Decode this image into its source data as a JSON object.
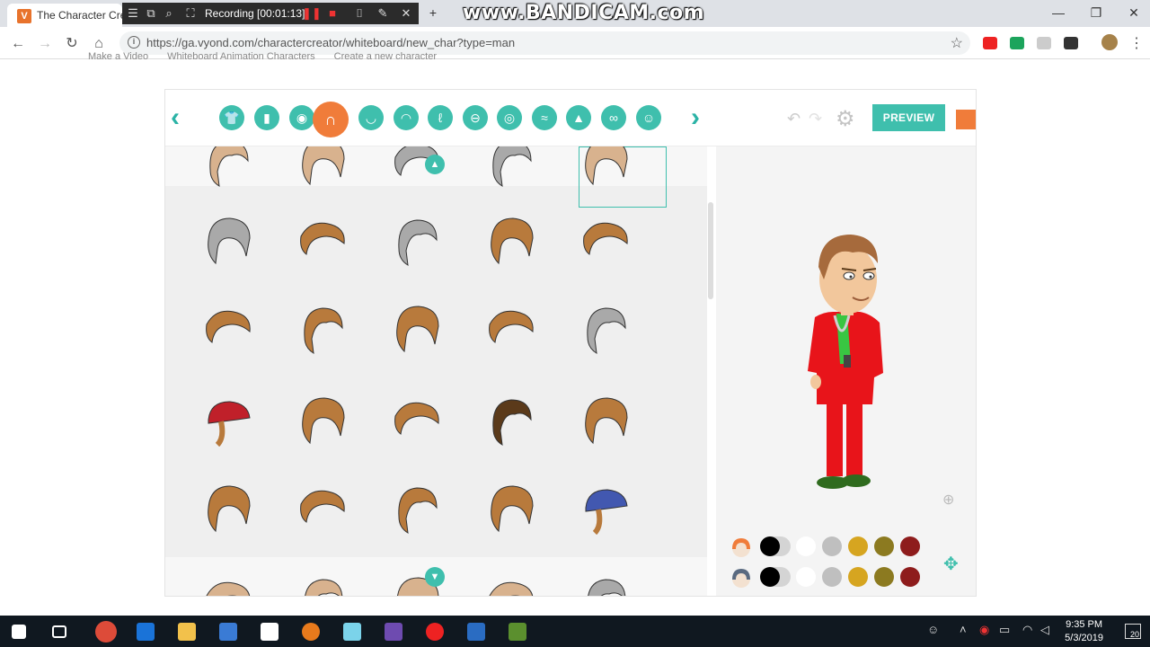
{
  "browser": {
    "tab_title": "The Character Crea",
    "tab_favicon_letter": "V",
    "url": "https://ga.vyond.com/charactercreator/whiteboard/new_char?type=man",
    "recording_label": "Recording [00:01:13]",
    "watermark": "www.BANDICAM.com"
  },
  "site_nav": {
    "items": [
      "Make a Video",
      "Whiteboard Animation Characters",
      "Create a new character"
    ]
  },
  "creator": {
    "categories": [
      {
        "name": "shirt",
        "glyph": "👕"
      },
      {
        "name": "pants",
        "glyph": "▮"
      },
      {
        "name": "face",
        "glyph": "◉"
      },
      {
        "name": "hair",
        "glyph": "∩"
      },
      {
        "name": "beard",
        "glyph": "◡"
      },
      {
        "name": "mouth",
        "glyph": "◠"
      },
      {
        "name": "ear",
        "glyph": "ℓ"
      },
      {
        "name": "nose",
        "glyph": "⊖"
      },
      {
        "name": "eyes",
        "glyph": "◎"
      },
      {
        "name": "eyebrows",
        "glyph": "≈"
      },
      {
        "name": "hat",
        "glyph": "▲"
      },
      {
        "name": "glasses",
        "glyph": "∞"
      },
      {
        "name": "misc",
        "glyph": "☺"
      }
    ],
    "active_category": "hair",
    "preview_label": "PREVIEW",
    "hair_colors": {
      "brown": "#b87a3c",
      "light": "#d8b28e",
      "grey": "#a9a9a9",
      "dark": "#5b3a1a",
      "red_cap": "#c0202a",
      "blue_cap": "#4258b0"
    },
    "swatches": [
      "#000000",
      "#ffffff",
      "#bfbfbf",
      "#d6a520",
      "#8c7a20",
      "#8e1c1c"
    ],
    "accent": "#3fbfad",
    "active_accent": "#f07c3a"
  },
  "taskbar": {
    "time": "9:35 PM",
    "date": "5/3/2019",
    "notifications": "20"
  }
}
